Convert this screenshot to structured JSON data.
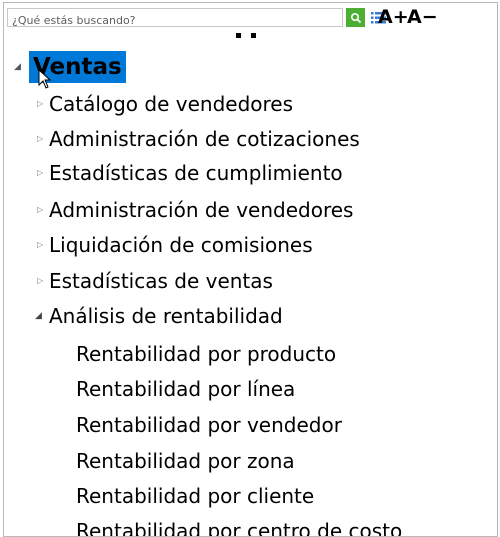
{
  "toolbar": {
    "search_placeholder": "¿Qué estás buscando?",
    "font_increase": "A+",
    "font_decrease": "A−",
    "accent": "#4caf33"
  },
  "tree": {
    "root": {
      "label": "Ventas",
      "expanded": true,
      "selected": true,
      "highlight": "#0078d7"
    },
    "children": [
      {
        "label": "Catálogo de vendedores",
        "expanded": false
      },
      {
        "label": "Administración de cotizaciones",
        "expanded": false
      },
      {
        "label": "Estadísticas de cumplimiento",
        "expanded": false
      },
      {
        "label": "Administración de vendedores",
        "expanded": false
      },
      {
        "label": "Liquidación de comisiones",
        "expanded": false
      },
      {
        "label": "Estadísticas de ventas",
        "expanded": false
      },
      {
        "label": "Análisis de rentabilidad",
        "expanded": true,
        "children": [
          "Rentabilidad por producto",
          "Rentabilidad por línea",
          "Rentabilidad por vendedor",
          "Rentabilidad por zona",
          "Rentabilidad por cliente",
          "Rentabilidad por centro de costo"
        ]
      }
    ]
  }
}
